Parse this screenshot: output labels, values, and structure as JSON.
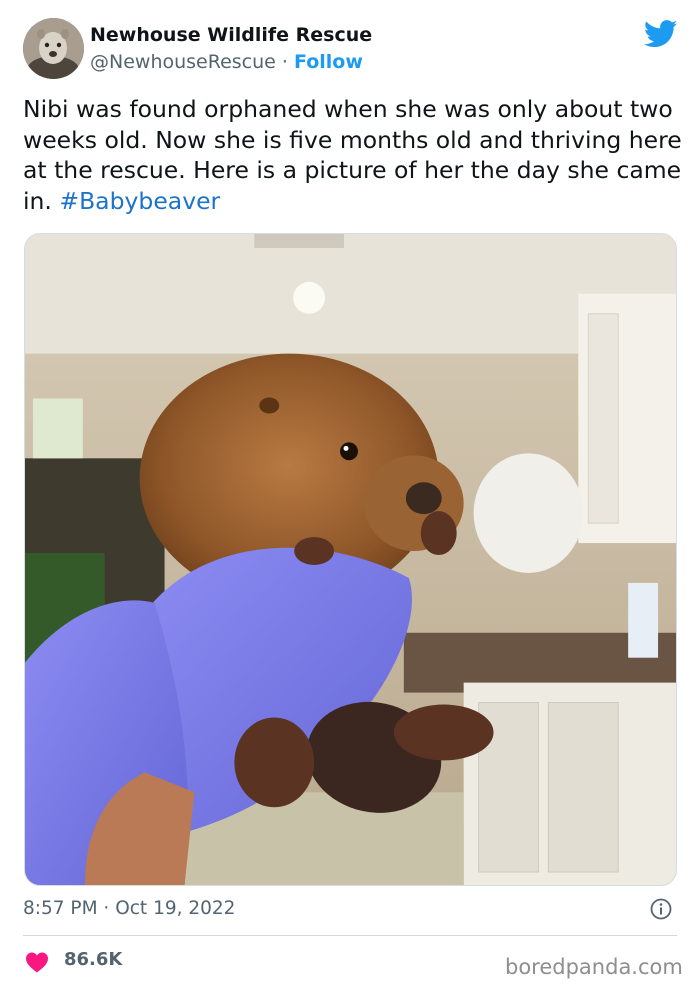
{
  "tweet": {
    "author_name": "Newhouse Wildlife Rescue",
    "author_handle": "@NewhouseRescue",
    "separator": " · ",
    "follow_label": "Follow",
    "text_main": "Nibi was found orphaned when she was only about two weeks old. Now she is five months old and thriving here at the rescue. Here is a picture of her the day she came in. ",
    "hashtag": "#Babybeaver",
    "time": "8:57 PM",
    "date": "Oct 19, 2022",
    "likes": "86.6K"
  },
  "icons": {
    "brand": "twitter-bird-icon",
    "info": "info-icon",
    "like": "heart-icon"
  },
  "colors": {
    "link_blue": "#1d9bf0",
    "hashtag_blue": "#1d73c9",
    "heart_pink": "#f91880",
    "muted_text": "#536471"
  },
  "watermark": "boredpanda.com"
}
